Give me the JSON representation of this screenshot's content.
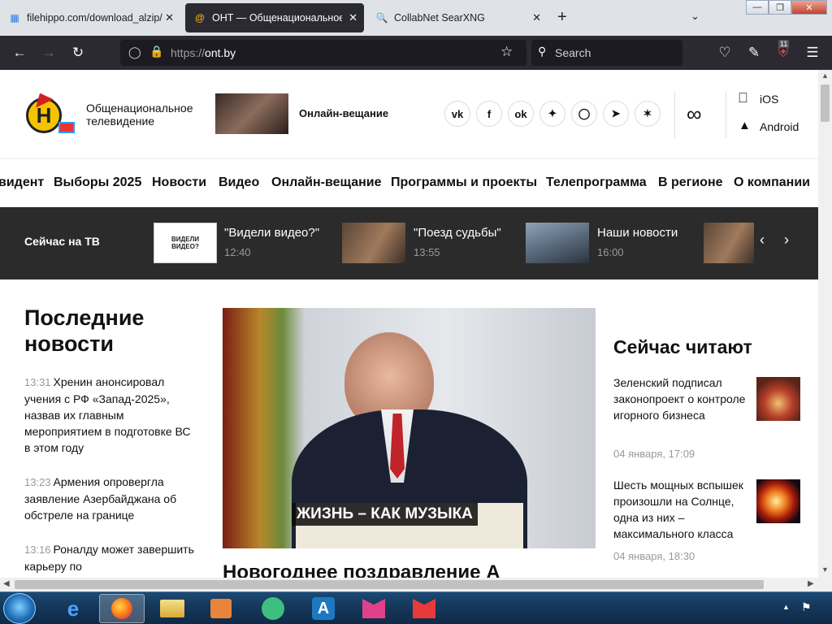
{
  "browser": {
    "tabs": [
      {
        "title": "filehippo.com/download_alzip/",
        "icon": "page-icon",
        "active": false
      },
      {
        "title": "ОНТ — Общенациональное телевидение",
        "icon": "ont-favicon",
        "active": true
      },
      {
        "title": "CollabNet SearXNG",
        "icon": "search-icon",
        "active": false
      }
    ],
    "new_tab": "+",
    "url_prefix": "https://",
    "url_host": "ont.by",
    "search_placeholder": "Search",
    "extensions_badge": "11"
  },
  "site": {
    "logo_text": "Н",
    "channel_name_line1": "Общенациональное",
    "channel_name_line2": "телевидение",
    "live_label": "Онлайн-вещание",
    "social": [
      {
        "name": "vk-icon",
        "glyph": "vk"
      },
      {
        "name": "facebook-icon",
        "glyph": "f"
      },
      {
        "name": "odnoklassniki-icon",
        "glyph": "ok"
      },
      {
        "name": "twitter-icon",
        "glyph": "tw"
      },
      {
        "name": "instagram-icon",
        "glyph": "ig"
      },
      {
        "name": "telegram-icon",
        "glyph": "tg"
      },
      {
        "name": "yandex-zen-icon",
        "glyph": "z"
      }
    ],
    "apps": [
      {
        "label": "iOS"
      },
      {
        "label": "Android"
      }
    ],
    "menu": [
      "видент",
      "Выборы 2025",
      "Новости",
      "Видео",
      "Онлайн-вещание",
      "Программы и проекты",
      "Телепрограмма",
      "В регионе",
      "О компании"
    ],
    "now_on_tv_label": "Сейчас на ТВ",
    "tv_items": [
      {
        "title": "\"Видели видео?\"",
        "time": "12:40",
        "thumb_text": "ВИДЕЛИ ВИДЕО?"
      },
      {
        "title": "\"Поезд судьбы\"",
        "time": "13:55"
      },
      {
        "title": "Наши новости",
        "time": "16:00"
      }
    ],
    "latest_heading_line1": "Последние",
    "latest_heading_line2": "новости",
    "latest": [
      {
        "time": "13:31",
        "text": "Хренин анонсировал учения с РФ «Запад-2025», назвав их главным мероприятием в подготовке ВС в этом году"
      },
      {
        "time": "13:23",
        "text": "Армения опровергла заявление Азербайджана об обстреле на границе"
      },
      {
        "time": "13:16",
        "text": "Роналду может завершить карьеру по"
      }
    ],
    "hero_caption": "ЖИЗНЬ – КАК МУЗЫКА",
    "hero_title": "Новогоднее поздравление А",
    "reading_heading": "Сейчас читают",
    "reading": [
      {
        "text": "Зеленский подписал законопроект о контроле игорного бизнеса",
        "date": "04 января, 17:09"
      },
      {
        "text": "Шесть мощных вспышек произошли на Солнце, одна из них – максимального класса",
        "date": "04 января, 18:30"
      }
    ]
  },
  "taskbar": {
    "apps": [
      "internet-explorer",
      "firefox",
      "file-explorer",
      "media-player",
      "greenshot",
      "linux-app",
      "gitkraken-1",
      "gitkraken-2"
    ]
  }
}
